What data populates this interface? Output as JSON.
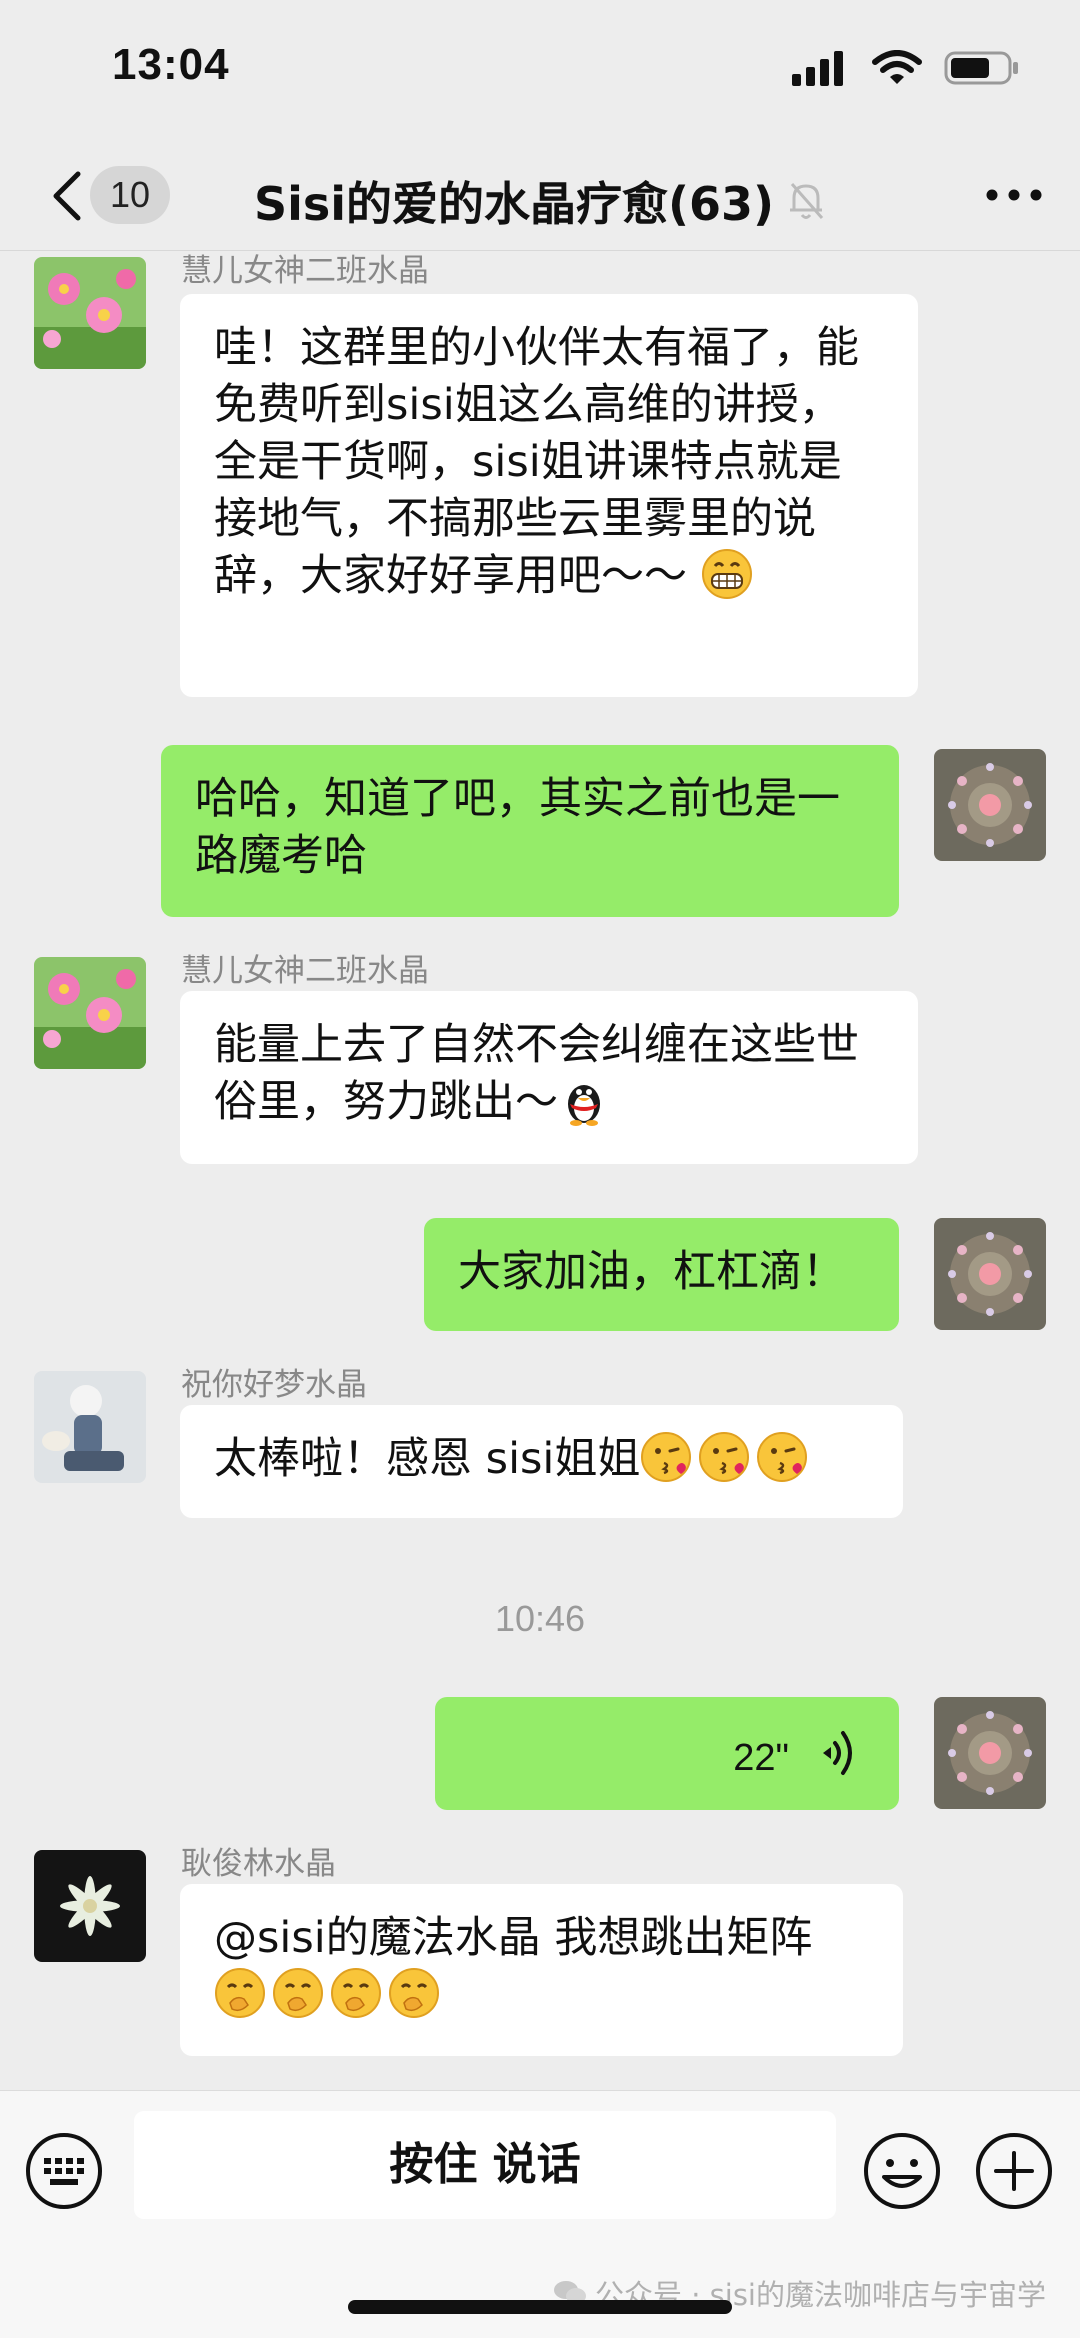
{
  "status_bar": {
    "time": "13:04"
  },
  "nav": {
    "badge": "10",
    "title": "Sisi的爱的水晶疗愈(63)"
  },
  "messages": [
    {
      "sender": "慧儿女神二班水晶",
      "text": "哇！这群里的小伙伴太有福了，能免费听到sisi姐这么高维的讲授，全是干货啊，sisi姐讲课特点就是接地气，不搞那些云里雾里的说辞，大家好好享用吧～～",
      "emoji": "grin-face"
    },
    {
      "text": "哈哈，知道了吧，其实之前也是一路魔考哈"
    },
    {
      "sender": "慧儿女神二班水晶",
      "text": "能量上去了自然不会纠缠在这些世俗里，努力跳出～",
      "emoji": "penguin"
    },
    {
      "text": "大家加油，杠杠滴！"
    },
    {
      "sender": "祝你好梦水晶",
      "text": "太棒啦！感恩 sisi姐姐",
      "emoji": "kiss-face"
    },
    {
      "timestamp": "10:46"
    },
    {
      "voice_duration": "22\""
    },
    {
      "sender": "耿俊林水晶",
      "text": "@sisi的魔法水晶 我想跳出矩阵",
      "emoji": "shush-face"
    }
  ],
  "input": {
    "talk_label": "按住 说话"
  },
  "watermark": "公众号 · sisi的魔法咖啡店与宇宙学",
  "colors": {
    "bubble_self": "#95ec69",
    "bubble_other": "#ffffff",
    "background": "#ededed"
  }
}
